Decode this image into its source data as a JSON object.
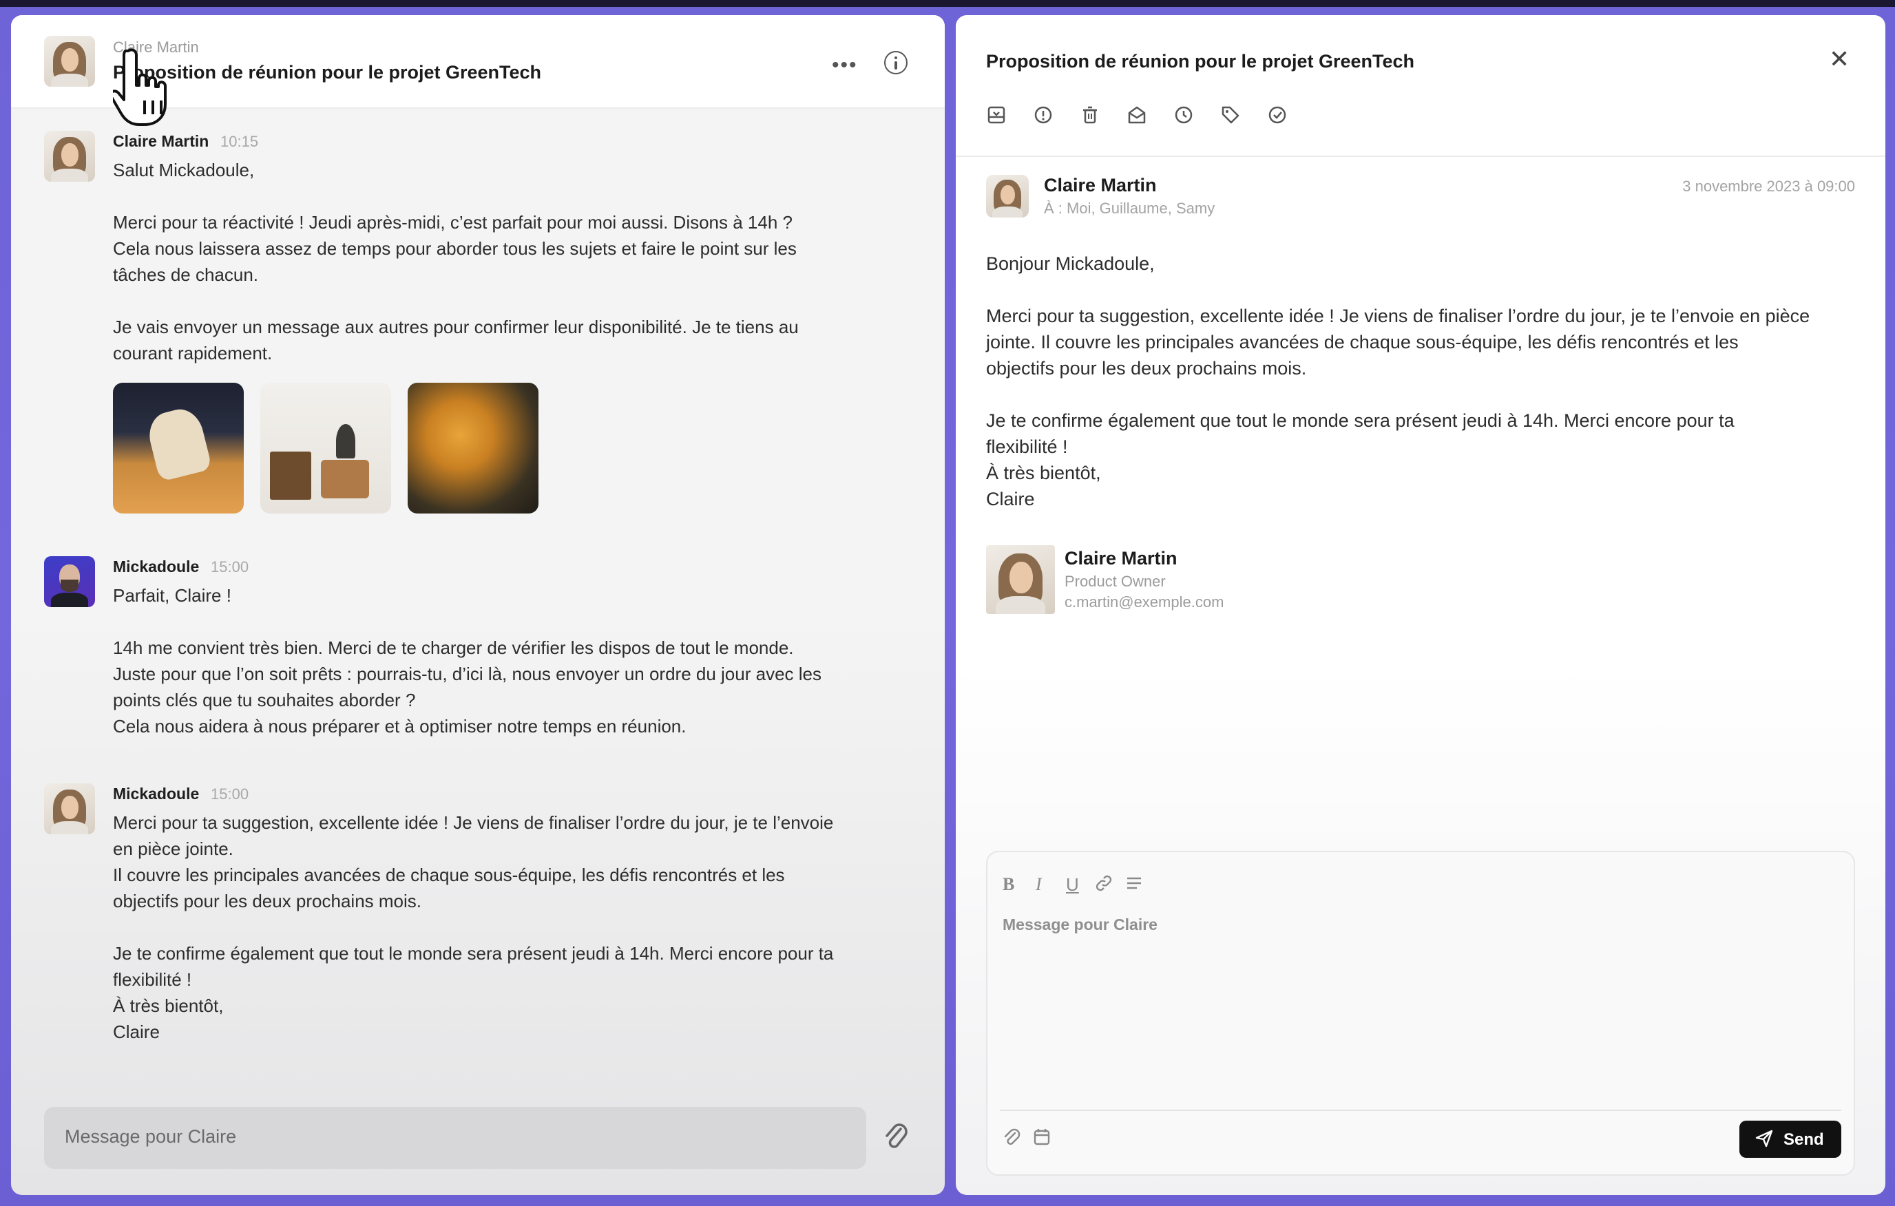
{
  "left": {
    "header": {
      "sender": "Claire Martin",
      "title": "Proposition de réunion pour le projet GreenTech",
      "more_icon": "more-horizontal-icon",
      "info_icon": "info-icon"
    },
    "messages": [
      {
        "author": "Claire Martin",
        "time": "10:15",
        "text": "Salut Mickadoule,\n\nMerci pour ta réactivité ! Jeudi après-midi, c’est parfait pour moi aussi. Disons à 14h ?\nCela nous laissera assez de temps pour aborder tous les sujets et faire le point sur les\ntâches de chacun.\n\nJe vais envoyer un message aux autres pour confirmer leur disponibilité. Je te tiens au\ncourant rapidement.",
        "attachments": [
          "car-photo",
          "room-photo",
          "leaves-photo"
        ]
      },
      {
        "author": "Mickadoule",
        "time": "15:00",
        "text": "Parfait, Claire !\n\n14h me convient très bien. Merci de te charger de vérifier les dispos de tout le monde.\nJuste pour que l’on soit prêts : pourrais-tu, d’ici là, nous envoyer un ordre du jour avec les\npoints clés que tu souhaites aborder ?\nCela nous aidera à nous préparer et à optimiser notre temps en réunion."
      },
      {
        "author": "Mickadoule",
        "time": "15:00",
        "text": "Merci pour ta suggestion, excellente idée ! Je viens de finaliser l’ordre du jour, je te l’envoie\nen pièce jointe.\nIl couvre les principales avancées de chaque sous-équipe, les défis rencontrés et les\nobjectifs pour les deux prochains mois.\n\nJe te confirme également que tout le monde sera présent jeudi à 14h. Merci encore pour ta\nflexibilité !\nÀ très bientôt,\nClaire"
      }
    ],
    "input": {
      "placeholder": "Message pour Claire",
      "attach_icon": "paperclip-icon"
    }
  },
  "right": {
    "title": "Proposition de réunion pour le projet GreenTech",
    "toolbar_icons": [
      "archive-icon",
      "alert-icon",
      "trash-icon",
      "mail-open-icon",
      "clock-icon",
      "tag-icon",
      "check-circle-icon"
    ],
    "email": {
      "from": "Claire Martin",
      "to": "À : Moi, Guillaume, Samy",
      "date": "3 novembre 2023 à 09:00",
      "body": "Bonjour Mickadoule,\n\nMerci pour ta suggestion, excellente idée ! Je viens de finaliser l’ordre du jour, je te l’envoie en pièce\njointe. Il couvre les principales avancées de chaque sous-équipe, les défis rencontrés et les\nobjectifs pour les deux prochains mois.\n\nJe te confirme également que tout le monde sera présent jeudi à 14h. Merci encore pour ta\nflexibilité !\nÀ très bientôt,\nClaire"
    },
    "signature": {
      "name": "Claire Martin",
      "role": "Product Owner",
      "email": "c.martin@exemple.com"
    },
    "composer": {
      "placeholder": "Message pour Claire",
      "format_icons": [
        "bold-icon",
        "italic-icon",
        "underline-icon",
        "link-icon",
        "align-icon"
      ],
      "send_label": "Send"
    }
  },
  "colors": {
    "frame": "#7466dc",
    "send_button": "#111111"
  }
}
